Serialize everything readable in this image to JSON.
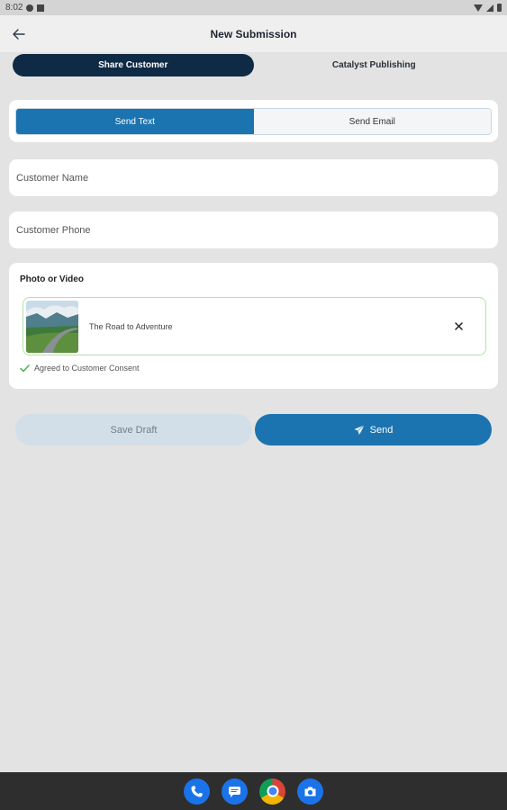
{
  "status_bar": {
    "time": "8:02"
  },
  "app_bar": {
    "title": "New Submission"
  },
  "top_tabs": [
    {
      "label": "Share Customer",
      "active": true
    },
    {
      "label": "Catalyst Publishing",
      "active": false
    }
  ],
  "send_mode": {
    "options": [
      {
        "label": "Send Text",
        "active": true
      },
      {
        "label": "Send Email",
        "active": false
      }
    ]
  },
  "form": {
    "customer_name": {
      "placeholder": "Customer Name",
      "value": ""
    },
    "customer_phone": {
      "placeholder": "Customer Phone",
      "value": ""
    }
  },
  "media": {
    "label": "Photo or Video",
    "item_name": "The Road to Adventure",
    "consent_text": "Agreed to Customer Consent"
  },
  "actions": {
    "save_draft": "Save Draft",
    "send": "Send"
  },
  "colors": {
    "primary": "#1b74b0",
    "dark_tab": "#0e2a45",
    "consent_check": "#4caf50",
    "media_border": "#b6dfaa"
  },
  "dock": [
    "phone-icon",
    "messages-icon",
    "chrome-icon",
    "camera-icon"
  ]
}
